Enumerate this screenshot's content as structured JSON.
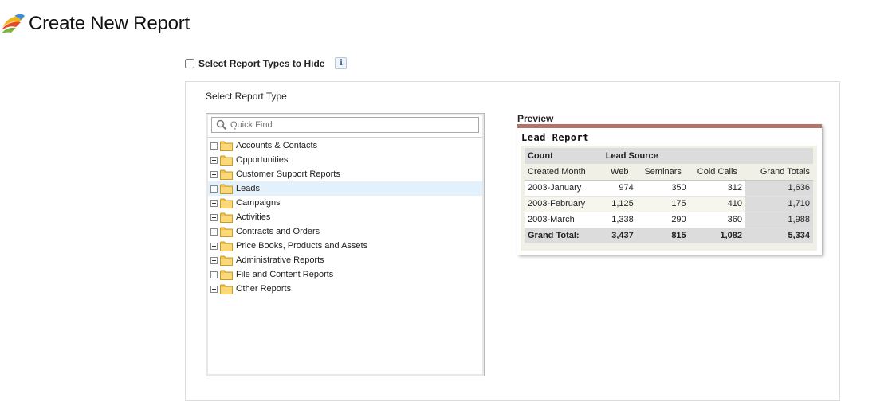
{
  "header": {
    "title": "Create New Report"
  },
  "hide_types": {
    "label": "Select Report Types to Hide",
    "checked": false,
    "info_glyph": "i"
  },
  "panel": {
    "label": "Select Report Type"
  },
  "search": {
    "placeholder": "Quick Find",
    "value": ""
  },
  "report_types": [
    {
      "label": "Accounts & Contacts",
      "selected": false
    },
    {
      "label": "Opportunities",
      "selected": false
    },
    {
      "label": "Customer Support Reports",
      "selected": false
    },
    {
      "label": "Leads",
      "selected": true
    },
    {
      "label": "Campaigns",
      "selected": false
    },
    {
      "label": "Activities",
      "selected": false
    },
    {
      "label": "Contracts and Orders",
      "selected": false
    },
    {
      "label": "Price Books, Products and Assets",
      "selected": false
    },
    {
      "label": "Administrative Reports",
      "selected": false
    },
    {
      "label": "File and Content Reports",
      "selected": false
    },
    {
      "label": "Other Reports",
      "selected": false
    }
  ],
  "preview": {
    "title": "Preview",
    "report_name": "Lead Report",
    "count_label": "Count",
    "group_label": "Lead Source",
    "columns": [
      "Created Month",
      "Web",
      "Seminars",
      "Cold Calls",
      "Grand Totals"
    ],
    "rows": [
      [
        "2003-January",
        "974",
        "350",
        "312",
        "1,636"
      ],
      [
        "2003-February",
        "1,125",
        "175",
        "410",
        "1,710"
      ],
      [
        "2003-March",
        "1,338",
        "290",
        "360",
        "1,988"
      ]
    ],
    "total": [
      "Grand Total:",
      "3,437",
      "815",
      "1,082",
      "5,334"
    ]
  },
  "colors": {
    "preview_accent": "#b0756a",
    "selected_row": "#e3f1fc",
    "folder": "#f5c24a"
  }
}
